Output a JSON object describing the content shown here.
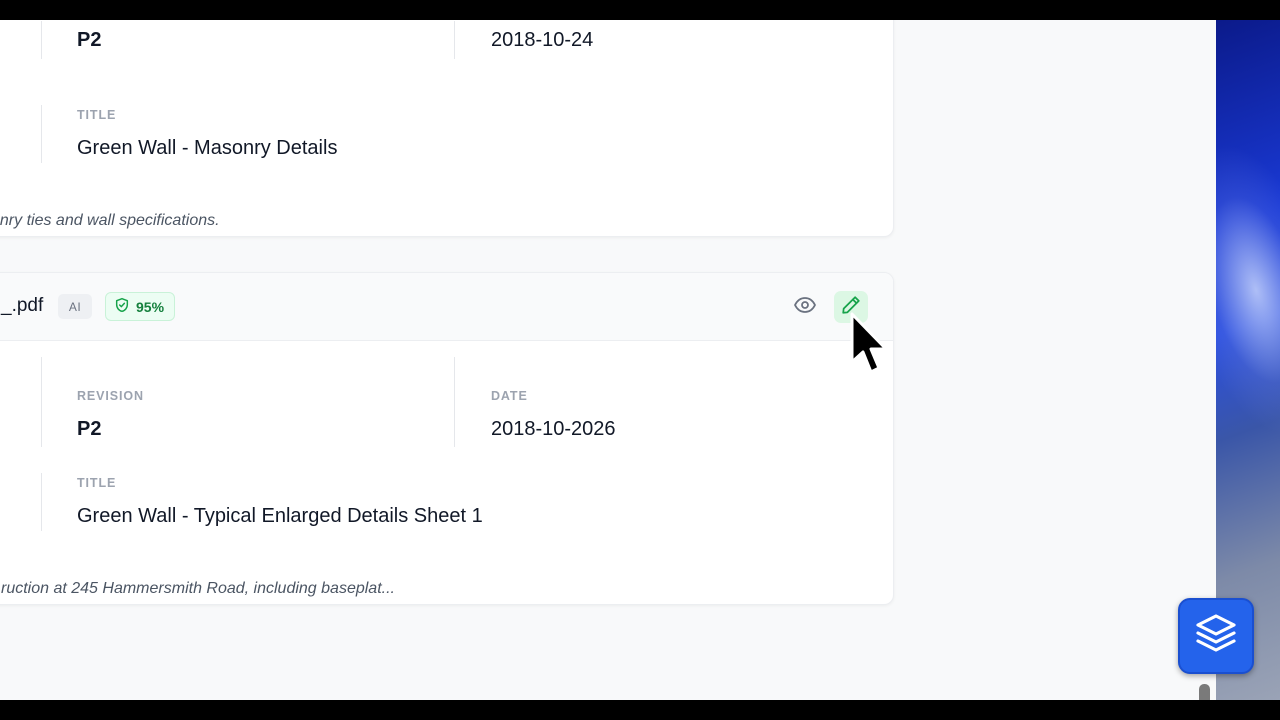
{
  "card1": {
    "revision_value": "P2",
    "date_value": "2018-10-24",
    "title_label": "TITLE",
    "title_value": "Green Wall - Masonry Details",
    "description": "onry ties and wall specifications."
  },
  "card2": {
    "filename": "_.pdf",
    "ai_badge": "AI",
    "confidence": "95%",
    "revision_label": "REVISION",
    "revision_value": "P2",
    "date_label": "DATE",
    "date_value": "2018-10-2026",
    "title_label": "TITLE",
    "title_value": "Green Wall - Typical Enlarged Details Sheet 1",
    "description": "ruction at 245 Hammersmith Road, including baseplat..."
  },
  "icons": {
    "confidence": "shield-check-icon",
    "view": "eye-icon",
    "edit": "pencil-icon",
    "fab": "layers-icon"
  },
  "colors": {
    "accent": "#2463eb",
    "success": "#15803d",
    "success_bg": "#dcf7e4"
  }
}
